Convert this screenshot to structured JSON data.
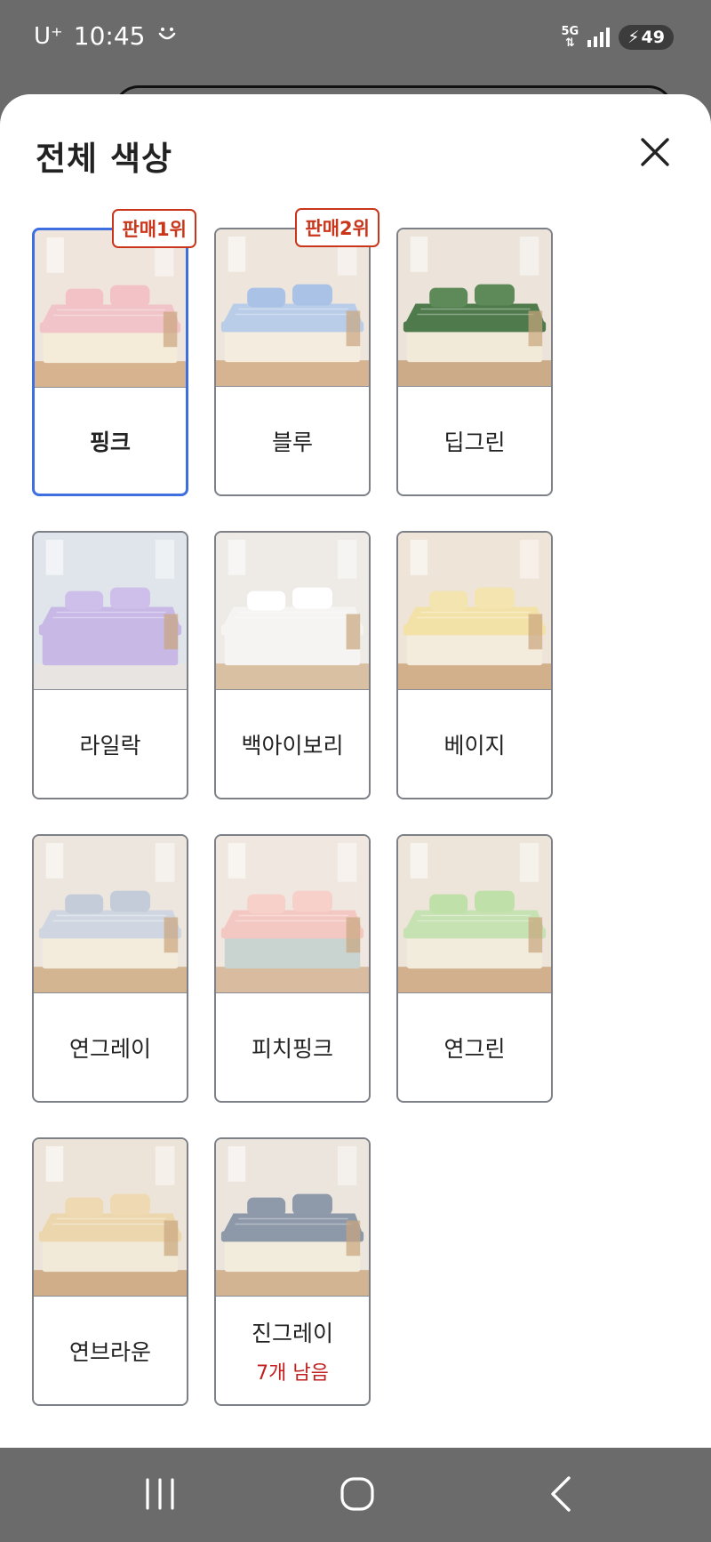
{
  "status_bar": {
    "carrier": "U⁺",
    "time": "10:45",
    "face_icon": "smile-icon",
    "network": "5G",
    "battery_level": "49"
  },
  "sheet": {
    "title": "전체 색상",
    "close_icon": "close-icon"
  },
  "options": [
    {
      "name": "핑크",
      "badge": "판매1위",
      "note": "",
      "selected": true,
      "bed": "#f0c4c8",
      "pillow": "#f2c2c7",
      "base": "#f4ecd9",
      "wall": "#efe5dc",
      "floor": "#d7b390"
    },
    {
      "name": "블루",
      "badge": "판매2위",
      "note": "",
      "selected": false,
      "bed": "#b9cde9",
      "pillow": "#a9c2e6",
      "base": "#f3ecdf",
      "wall": "#eee6dd",
      "floor": "#d6b491"
    },
    {
      "name": "딥그린",
      "badge": "",
      "note": "",
      "selected": false,
      "bed": "#4e7a4c",
      "pillow": "#5d8a58",
      "base": "#f2ead8",
      "wall": "#ece4da",
      "floor": "#ccab88"
    },
    {
      "name": "라일락",
      "badge": "",
      "note": "",
      "selected": false,
      "bed": "#c7b8e6",
      "pillow": "#cdbfea",
      "base": "#c7b8e6",
      "wall": "#dfe5ea",
      "floor": "#e8e4e2"
    },
    {
      "name": "백아이보리",
      "badge": "",
      "note": "",
      "selected": false,
      "bed": "#f5f4f2",
      "pillow": "#ffffff",
      "base": "#f5f4f2",
      "wall": "#eeebe7",
      "floor": "#dac0a2"
    },
    {
      "name": "베이지",
      "badge": "",
      "note": "",
      "selected": false,
      "bed": "#f3e2a8",
      "pillow": "#f4e4b0",
      "base": "#f3ecdc",
      "wall": "#eee4d7",
      "floor": "#d3b08c"
    },
    {
      "name": "연그레이",
      "badge": "",
      "note": "",
      "selected": false,
      "bed": "#cfd6e1",
      "pillow": "#c3ccd8",
      "base": "#f3ecdc",
      "wall": "#ede6de",
      "floor": "#d4b592"
    },
    {
      "name": "피치핑크",
      "badge": "",
      "note": "",
      "selected": false,
      "bed": "#f4c8c2",
      "pillow": "#f7d0c9",
      "base": "#c9d3cf",
      "wall": "#f0e8e0",
      "floor": "#d9bca0"
    },
    {
      "name": "연그린",
      "badge": "",
      "note": "",
      "selected": false,
      "bed": "#c6e2b2",
      "pillow": "#bfe0a8",
      "base": "#f2ecdc",
      "wall": "#ede5da",
      "floor": "#d2b08d"
    },
    {
      "name": "연브라운",
      "badge": "",
      "note": "",
      "selected": false,
      "bed": "#ecd6ad",
      "pillow": "#eed9b2",
      "base": "#f2ead8",
      "wall": "#ede4d9",
      "floor": "#d0ae8a"
    },
    {
      "name": "진그레이",
      "badge": "",
      "note": "7개 남음",
      "selected": false,
      "bed": "#8d98a8",
      "pillow": "#8e99a9",
      "base": "#f2ecdc",
      "wall": "#ece5dd",
      "floor": "#d2b392"
    }
  ],
  "nav": {
    "recents_icon": "recents-icon",
    "home_icon": "home-icon",
    "back_icon": "back-icon"
  }
}
